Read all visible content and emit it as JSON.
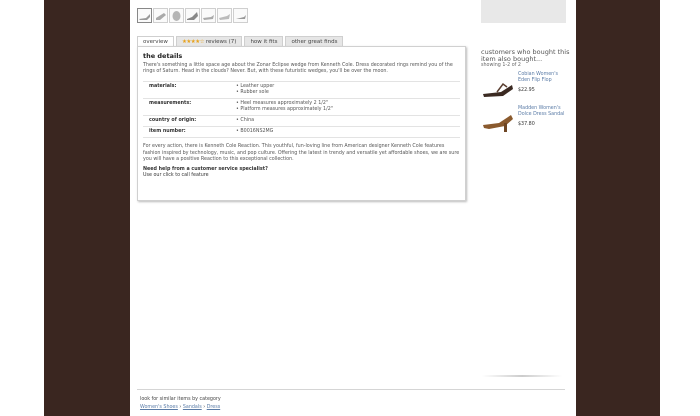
{
  "thumbnails": [
    "sandal-angle-1",
    "sandal-angle-2",
    "sandal-angle-3",
    "sandal-angle-4",
    "sandal-angle-5",
    "sandal-angle-6",
    "sandal-angle-7"
  ],
  "tabs": {
    "overview": "overview",
    "reviews": "reviews (7)",
    "how_it_fits": "how it fits",
    "other_finds": "other great finds"
  },
  "rating_stars": "★★★★☆",
  "details": {
    "heading": "the details",
    "intro": "There's something a little space age about the Zonar Eclipse wedge from Kenneth Cole. Dress decorated rings remind you of the rings of Saturn. Head in the clouds? Never. But, with these futuristic wedges, you'll be over the moon.",
    "specs": [
      {
        "label": "materials:",
        "lines": [
          "• Leather upper",
          "• Rubber sole"
        ]
      },
      {
        "label": "measurements:",
        "lines": [
          "• Heel measures approximately 2 1/2\"",
          "• Platform measures approximately 1/2\""
        ]
      },
      {
        "label": "country of origin:",
        "lines": [
          "• China"
        ]
      },
      {
        "label": "item number:",
        "lines": [
          "• B0016NS2MG"
        ]
      }
    ],
    "description": "For every action, there is Kenneth Cole Reaction. This youthful, fun-loving line from American designer Kenneth Cole features fashion inspired by technology, music, and pop culture. Offering the latest in trendy and versatile yet affordable shoes, we are sure you will have a positive Reaction to this exceptional collection.",
    "help_title": "Need help from a customer service specialist?",
    "help_text": "Use our click to call feature"
  },
  "also_bought": {
    "title": "customers who bought this item also bought...",
    "count": "showing 1-2 of 2",
    "items": [
      {
        "name": "Cobian Women's Eden Flip Flop",
        "price": "$22.95"
      },
      {
        "name": "Madden Women's Dolce Dress Sandal",
        "price": "$37.80"
      }
    ]
  },
  "footer": {
    "label": "look for similar items by category",
    "crumbs": [
      "Women's Shoes",
      "Sandals",
      "Dress"
    ],
    "separator": "›"
  }
}
